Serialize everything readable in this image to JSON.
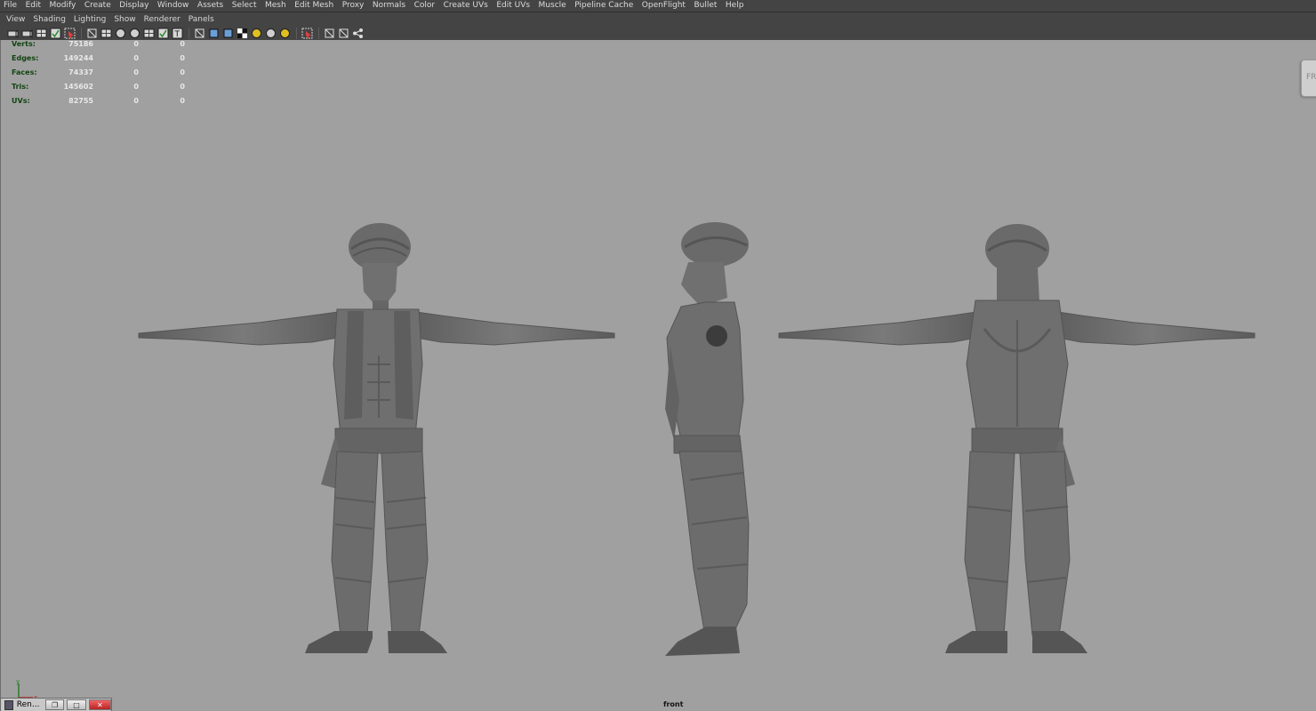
{
  "menubar": {
    "items": [
      "File",
      "Edit",
      "Modify",
      "Create",
      "Display",
      "Window",
      "Assets",
      "Select",
      "Mesh",
      "Edit Mesh",
      "Proxy",
      "Normals",
      "Color",
      "Create UVs",
      "Edit UVs",
      "Muscle",
      "Pipeline Cache",
      "OpenFlight",
      "Bullet",
      "Help"
    ]
  },
  "panel_menu": {
    "items": [
      "View",
      "Shading",
      "Lighting",
      "Show",
      "Renderer",
      "Panels"
    ]
  },
  "toolbar_icons": [
    "camera-attributes-icon",
    "select-camera-icon",
    "bookmark-icon",
    "image-plane-icon",
    "camera-lock-icon",
    "grid-icon",
    "film-gate-icon",
    "resolution-gate-icon",
    "gate-mask-icon",
    "field-chart-icon",
    "safe-action-icon",
    "safe-title-icon",
    "wireframe-icon",
    "smooth-shade-icon",
    "textured-icon",
    "xray-icon",
    "default-light-icon",
    "use-all-lights-icon",
    "shadows-icon",
    "isolate-select-icon",
    "backface-icon",
    "xray-joints-icon",
    "multi-sample-icon"
  ],
  "hud": {
    "rows": [
      {
        "label": "Verts:",
        "values": [
          "75186",
          "0",
          "0"
        ]
      },
      {
        "label": "Edges:",
        "values": [
          "149244",
          "0",
          "0"
        ]
      },
      {
        "label": "Faces:",
        "values": [
          "74337",
          "0",
          "0"
        ]
      },
      {
        "label": "Tris:",
        "values": [
          "145602",
          "0",
          "0"
        ]
      },
      {
        "label": "UVs:",
        "values": [
          "82755",
          "0",
          "0"
        ]
      }
    ]
  },
  "viewcube": {
    "label": "FRONT"
  },
  "camera": {
    "name": "front"
  },
  "minimized_window": {
    "title": "Ren..."
  },
  "colors": {
    "menu_bg": "#444444",
    "viewport_bg": "#a0a0a0",
    "hud_label": "#114411",
    "hud_value": "#e8e8e8",
    "mesh": "#6e6e6e"
  }
}
